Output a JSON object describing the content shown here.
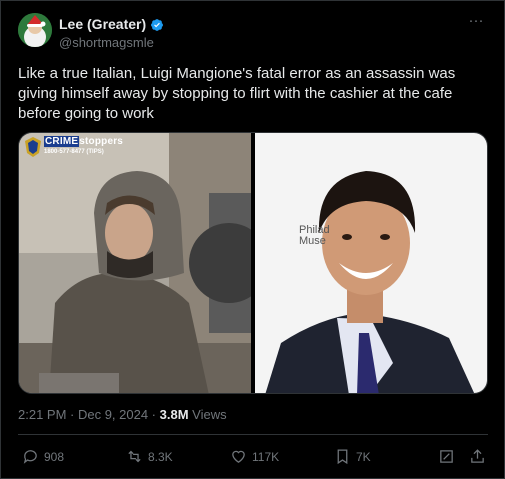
{
  "tweet": {
    "display_name": "Lee (Greater)",
    "handle": "@shortmagsmle",
    "verified": true,
    "more_icon": "more-dots-icon",
    "text": "Like a true Italian, Luigi Mangione's fatal error as an assassin was giving himself away by stopping to flirt with the cashier at the cafe before going to work",
    "media": {
      "left_logo_word": "CRIME",
      "left_logo_word2": "stoppers",
      "left_logo_phone": "1800-577-8477 (TIPS)",
      "right_sign_line1": "Philad",
      "right_sign_line2": "Muse"
    },
    "timestamp": "2:21 PM · Dec 9, 2024 · ",
    "views_count": "3.8M",
    "views_label": " Views",
    "actions": {
      "replies": "908",
      "reposts": "8.3K",
      "likes": "117K",
      "bookmarks": "7K"
    }
  },
  "colors": {
    "background": "#000000",
    "text": "#e7e9ea",
    "muted": "#71767b",
    "verified": "#1d9bf0",
    "border": "#2f3336"
  }
}
